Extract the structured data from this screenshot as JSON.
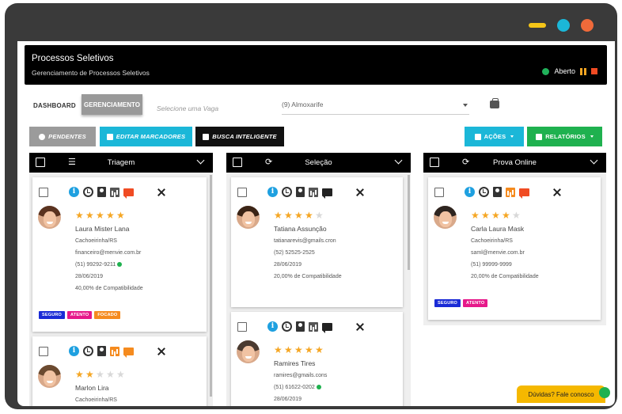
{
  "window": {
    "controls": [
      {
        "name": "minimize",
        "color": "#f5c518"
      },
      {
        "name": "maximize",
        "color": "#1bb7d8"
      },
      {
        "name": "close",
        "color": "#f06a3a"
      }
    ]
  },
  "header": {
    "title": "Processos Seletivos",
    "subtitle": "Gerenciamento de Processos Seletivos",
    "status_label": "Aberto"
  },
  "nav": {
    "dashboard": "DASHBOARD",
    "gerenciamento": "GERENCIAMENTO"
  },
  "vaga": {
    "label": "Selecione uma Vaga",
    "value": "(9) Almoxarife"
  },
  "buttons": {
    "pendentes": "PENDENTES",
    "editar": "EDITAR MARCADORES",
    "busca": "BUSCA INTELIGENTE",
    "acoes": "AÇÕES",
    "relatorios": "RELATÓRIOS"
  },
  "columns": [
    {
      "title": "Triagem",
      "cards": [
        {
          "name": "Laura Mister Lana",
          "city": "Cachoeirinha/RS",
          "email": "financeiro@menvie.com.br",
          "phone": "(51) 99292-9211",
          "date": "28/06/2019",
          "compat": "40,00% de Compatibilidade",
          "stars": 5,
          "tags": [
            {
              "label": "SEGURO",
              "color": "#1a2bd6"
            },
            {
              "label": "ATENTO",
              "color": "#e6198a"
            },
            {
              "label": "FOCADO",
              "color": "#f58b1f"
            }
          ]
        },
        {
          "name": "Marlon Lira",
          "city": "Cachoeirinha/RS",
          "stars": 2
        }
      ]
    },
    {
      "title": "Seleção",
      "cards": [
        {
          "name": "Tatiana Assunção",
          "email": "tatianarevis@gmails.cron",
          "phone": "(52) 52525-2525",
          "date": "28/06/2019",
          "compat": "20,00% de Compatibilidade",
          "stars": 4
        },
        {
          "name": "Ramires Tires",
          "email": "ramires@gmails.cons",
          "phone": "(51) 61622-0202",
          "date": "28/06/2019",
          "stars": 5
        }
      ]
    },
    {
      "title": "Prova Online",
      "cards": [
        {
          "name": "Carla Laura Mask",
          "city": "Cachoeirinha/RS",
          "email": "saml@menvie.com.br",
          "phone": "(51) 99999-9999",
          "date": "28/06/2019",
          "compat": "20,00% de Compatibilidade",
          "stars": 4,
          "tags": [
            {
              "label": "SEGURO",
              "color": "#1a2bd6"
            },
            {
              "label": "ATENTO",
              "color": "#e6198a"
            }
          ]
        }
      ]
    }
  ],
  "help": {
    "label": "Dúvidas? Fale conosco"
  },
  "colors": {
    "star_on": "#f5a623",
    "star_off": "#d8d8d8",
    "icon_orange": "#f58b1f",
    "icon_gray": "#555555",
    "icon_red": "#f04b23"
  }
}
